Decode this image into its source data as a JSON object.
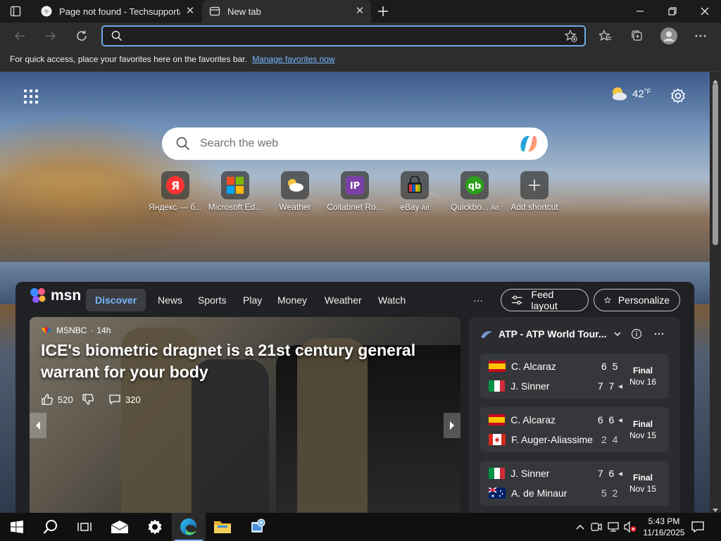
{
  "browser": {
    "tabs": [
      {
        "title": "Page not found - Techsupportal",
        "active": false
      },
      {
        "title": "New tab",
        "active": true
      }
    ],
    "address": {
      "value": "",
      "placeholder": ""
    },
    "favorites_bar": {
      "message": "For quick access, place your favorites here on the favorites bar.",
      "link": "Manage favorites now"
    }
  },
  "newtab": {
    "weather": {
      "temp": "42",
      "unit": "°F"
    },
    "search": {
      "placeholder": "Search the web"
    },
    "shortcuts": [
      {
        "label": "Яндекс — б...",
        "icon": "yandex-icon",
        "ad": ""
      },
      {
        "label": "Microsoft Ed...",
        "icon": "microsoft-icon",
        "ad": ""
      },
      {
        "label": "Weather",
        "icon": "weather-icon",
        "ad": ""
      },
      {
        "label": "Collabnet Ro...",
        "icon": "collabnet-icon",
        "ad": ""
      },
      {
        "label": "eBay",
        "icon": "ebay-icon",
        "ad": "Ad"
      },
      {
        "label": "Quickbo...",
        "icon": "quickbooks-icon",
        "ad": "Ad"
      },
      {
        "label": "Add shortcut",
        "icon": "plus-icon",
        "ad": ""
      }
    ]
  },
  "msn": {
    "logo": "msn",
    "nav": [
      "Discover",
      "News",
      "Sports",
      "Play",
      "Money",
      "Weather",
      "Watch"
    ],
    "more": "···",
    "feed_layout": "Feed layout",
    "personalize": "Personalize",
    "hero": {
      "source": "MSNBC",
      "age": "14h",
      "title": "ICE's biometric dragnet is a 21st century general warrant for your body",
      "likes": "520",
      "comments": "320"
    },
    "sports": {
      "league": "ATP - ATP World Tour...",
      "matches": [
        {
          "p1": {
            "name": "C. Alcaraz",
            "score": "6 5",
            "flag": "spain",
            "winner": true,
            "serve": false
          },
          "p2": {
            "name": "J. Sinner",
            "score": "7 7",
            "flag": "italy",
            "winner": true,
            "serve": true
          },
          "status": "Final",
          "date": "Nov 16"
        },
        {
          "p1": {
            "name": "C. Alcaraz",
            "score": "6 6",
            "flag": "spain",
            "winner": true,
            "serve": true
          },
          "p2": {
            "name": "F. Auger-Aliassime",
            "score": "2 4",
            "flag": "canada",
            "winner": false,
            "serve": false
          },
          "status": "Final",
          "date": "Nov 15"
        },
        {
          "p1": {
            "name": "J. Sinner",
            "score": "7 6",
            "flag": "italy",
            "winner": true,
            "serve": true
          },
          "p2": {
            "name": "A. de Minaur",
            "score": "5 2",
            "flag": "australia",
            "winner": false,
            "serve": false
          },
          "status": "Final",
          "date": "Nov 15"
        }
      ]
    }
  },
  "taskbar": {
    "time": "5:43 PM",
    "date": "11/16/2025"
  },
  "colors": {
    "accent": "#6aa9e6",
    "msn_panel": "#202124",
    "discover_text": "#7ab6ff"
  }
}
